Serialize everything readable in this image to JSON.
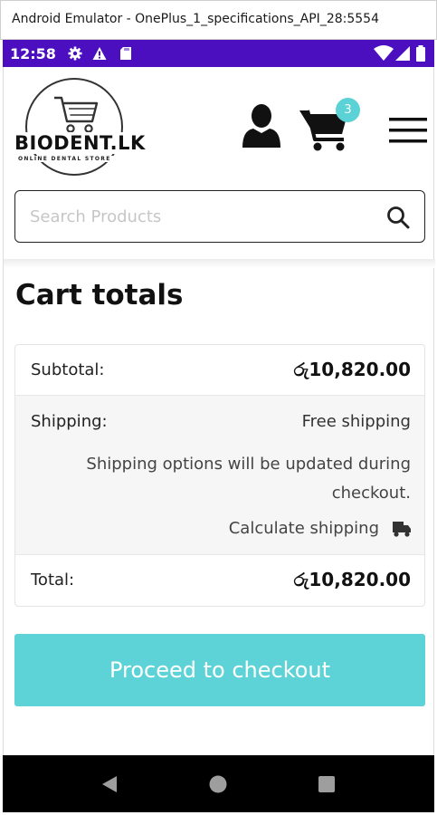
{
  "window": {
    "title": "Android Emulator - OnePlus_1_specifications_API_28:5554"
  },
  "status_bar": {
    "time": "12:58",
    "left_icons": [
      "gear-icon",
      "warning-icon",
      "sd-card-icon"
    ],
    "right_icons": [
      "wifi-icon",
      "signal-icon",
      "battery-icon"
    ],
    "background": "#4b0fc0"
  },
  "header": {
    "logo": {
      "name": "BIODENT.LK",
      "tagline": "ONLINE DENTAL STORE"
    },
    "account_icon": "user-icon",
    "cart": {
      "icon": "cart-icon",
      "count": "3"
    },
    "menu_icon": "hamburger-menu-icon"
  },
  "search": {
    "placeholder": "Search Products",
    "value": "",
    "icon": "search-icon"
  },
  "cart_totals": {
    "heading": "Cart totals",
    "subtotal_label": "Subtotal:",
    "subtotal_value": "රු10,820.00",
    "shipping_label": "Shipping:",
    "shipping_value": "Free shipping",
    "shipping_note": "Shipping options will be updated during checkout.",
    "calculate_shipping": "Calculate shipping",
    "total_label": "Total:",
    "total_value": "රු10,820.00"
  },
  "checkout_button": {
    "label": "Proceed to checkout",
    "color": "#5ed3d7"
  },
  "nav_bar": {
    "buttons": [
      "back-icon",
      "home-icon",
      "recents-icon"
    ]
  },
  "colors": {
    "accent": "#5bd2d6",
    "text": "#111111"
  }
}
